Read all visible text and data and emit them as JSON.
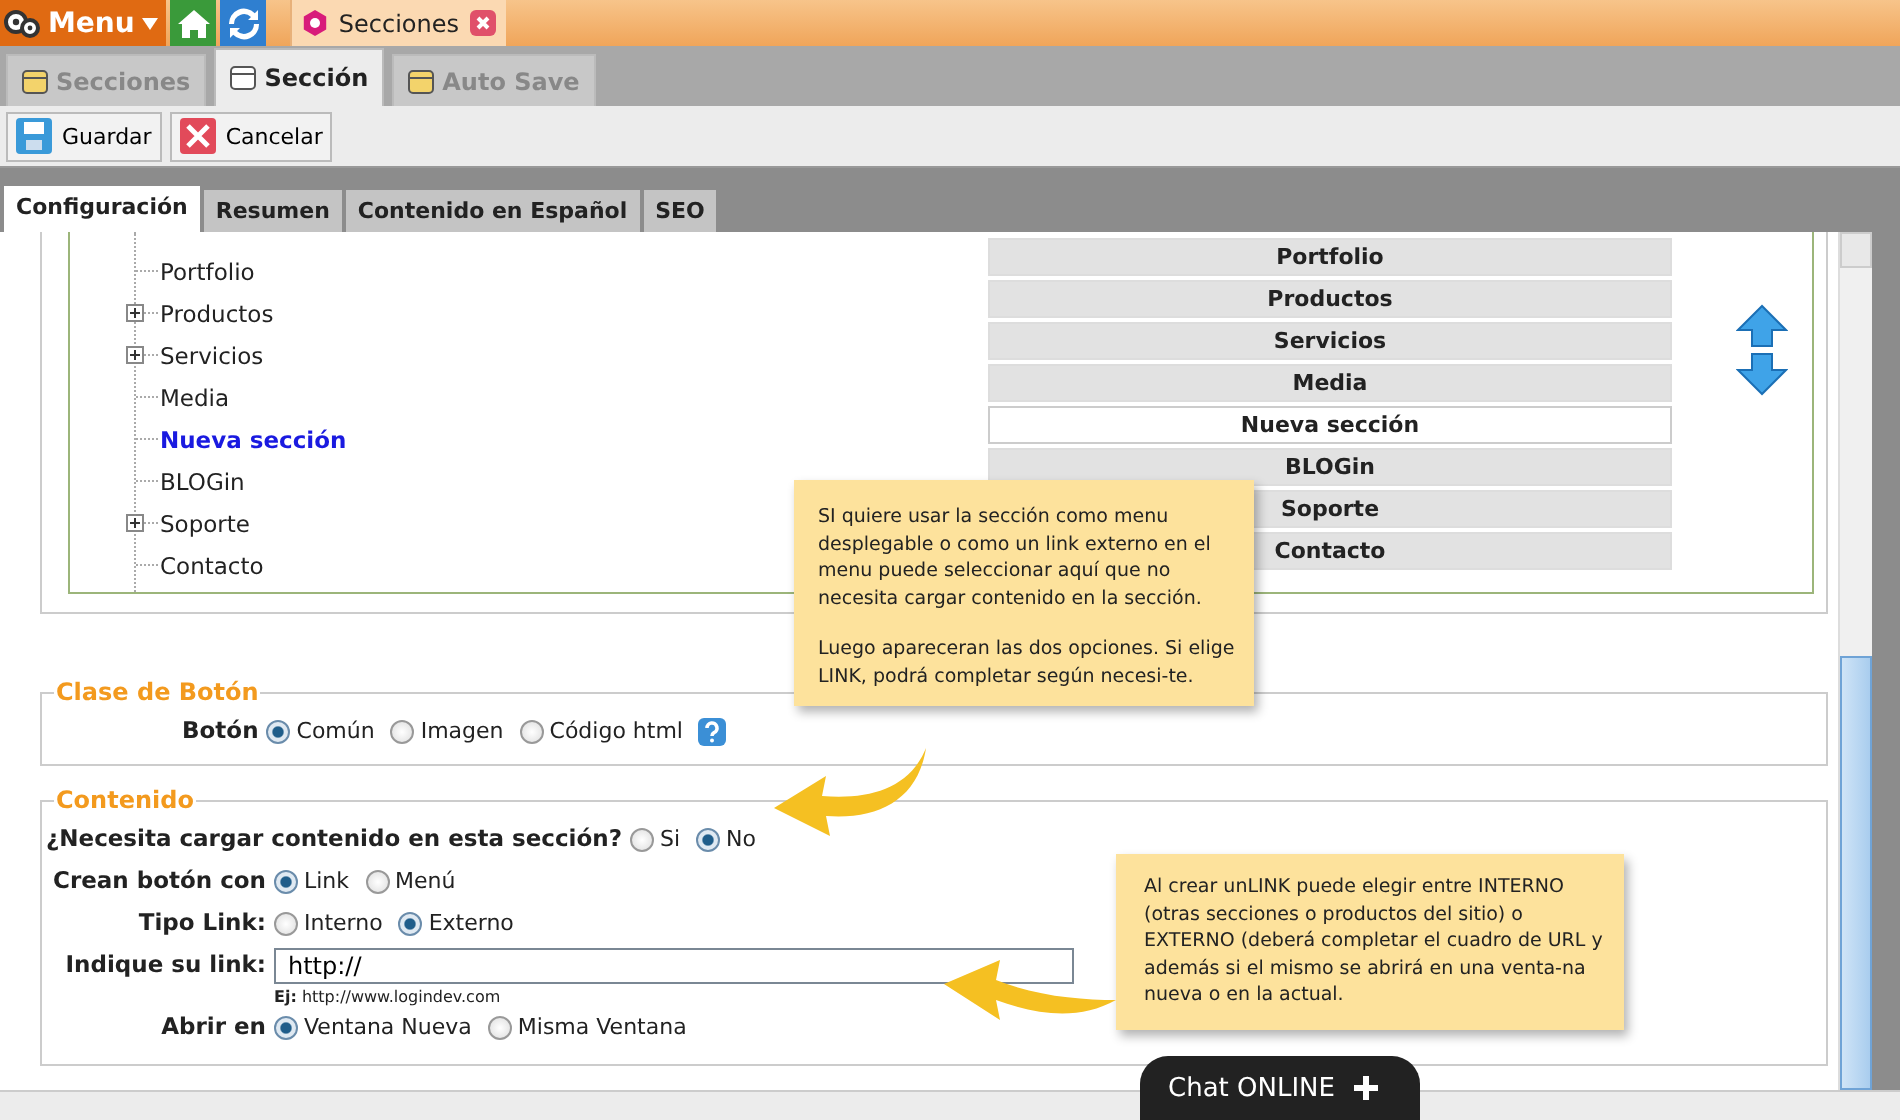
{
  "top_bar": {
    "menu_label": "Menu",
    "open_tab": {
      "label": "Secciones"
    }
  },
  "tabs": [
    {
      "label": "Secciones",
      "selected": false
    },
    {
      "label": "Sección",
      "selected": true
    },
    {
      "label": "Auto Save",
      "selected": false
    }
  ],
  "toolbar": [
    {
      "label": "Guardar",
      "kind": "save"
    },
    {
      "label": "Cancelar",
      "kind": "cancel"
    }
  ],
  "sub_tabs": [
    {
      "label": "Configuración",
      "selected": true
    },
    {
      "label": "Resumen",
      "selected": false
    },
    {
      "label": "Contenido en Español",
      "selected": false
    },
    {
      "label": "SEO",
      "selected": false
    }
  ],
  "tree": [
    {
      "label": "Portfolio",
      "expandable": false,
      "selected": false
    },
    {
      "label": "Productos",
      "expandable": true,
      "selected": false
    },
    {
      "label": "Servicios",
      "expandable": true,
      "selected": false
    },
    {
      "label": "Media",
      "expandable": false,
      "selected": false
    },
    {
      "label": "Nueva sección",
      "expandable": false,
      "selected": true
    },
    {
      "label": "BLOGin",
      "expandable": false,
      "selected": false
    },
    {
      "label": "Soporte",
      "expandable": true,
      "selected": false
    },
    {
      "label": "Contacto",
      "expandable": false,
      "selected": false
    }
  ],
  "order_list": [
    {
      "label": "Portfolio",
      "selected": false
    },
    {
      "label": "Productos",
      "selected": false
    },
    {
      "label": "Servicios",
      "selected": false
    },
    {
      "label": "Media",
      "selected": false
    },
    {
      "label": "Nueva sección",
      "selected": true
    },
    {
      "label": "BLOGin",
      "selected": false
    },
    {
      "label": "Soporte",
      "selected": false
    },
    {
      "label": "Contacto",
      "selected": false
    }
  ],
  "button_class": {
    "legend": "Clase de Botón",
    "label": "Botón",
    "options": [
      {
        "label": "Común",
        "selected": true
      },
      {
        "label": "Imagen",
        "selected": false
      },
      {
        "label": "Código html",
        "selected": false
      }
    ]
  },
  "content": {
    "legend": "Contenido",
    "rows": [
      {
        "kind": "radio",
        "label": "¿Necesita cargar contenido en esta sección?",
        "options": [
          {
            "label": "Si",
            "selected": false
          },
          {
            "label": "No",
            "selected": true
          }
        ]
      },
      {
        "kind": "radio",
        "label": "Crean botón con",
        "options": [
          {
            "label": "Link",
            "selected": true
          },
          {
            "label": "Menú",
            "selected": false
          }
        ]
      },
      {
        "kind": "radio",
        "label": "Tipo Link:",
        "options": [
          {
            "label": "Interno",
            "selected": false
          },
          {
            "label": "Externo",
            "selected": true
          }
        ]
      },
      {
        "kind": "input",
        "label": "Indique su link:",
        "value": "http://",
        "hint_label": "Ej:",
        "hint": "http://www.logindev.com"
      },
      {
        "kind": "radio",
        "label": "Abrir en",
        "options": [
          {
            "label": "Ventana Nueva",
            "selected": true
          },
          {
            "label": "Misma Ventana",
            "selected": false
          }
        ]
      }
    ]
  },
  "callouts": [
    {
      "text": "SI quiere usar la sección como menu desplegable o como un link externo en el menu puede seleccionar aquí que no necesita cargar contenido en la sección.",
      "text_2": "Luego apareceran las dos opciones. Si elige LINK, podrá completar según necesi-te."
    },
    {
      "text": "Al crear unLINK puede elegir entre INTERNO (otras secciones o productos del sitio) o EXTERNO (deberá completar el cuadro de URL y además si el mismo se abrirá en una venta-na nueva o en la actual."
    }
  ],
  "chat": {
    "label": "Chat ONLINE"
  }
}
